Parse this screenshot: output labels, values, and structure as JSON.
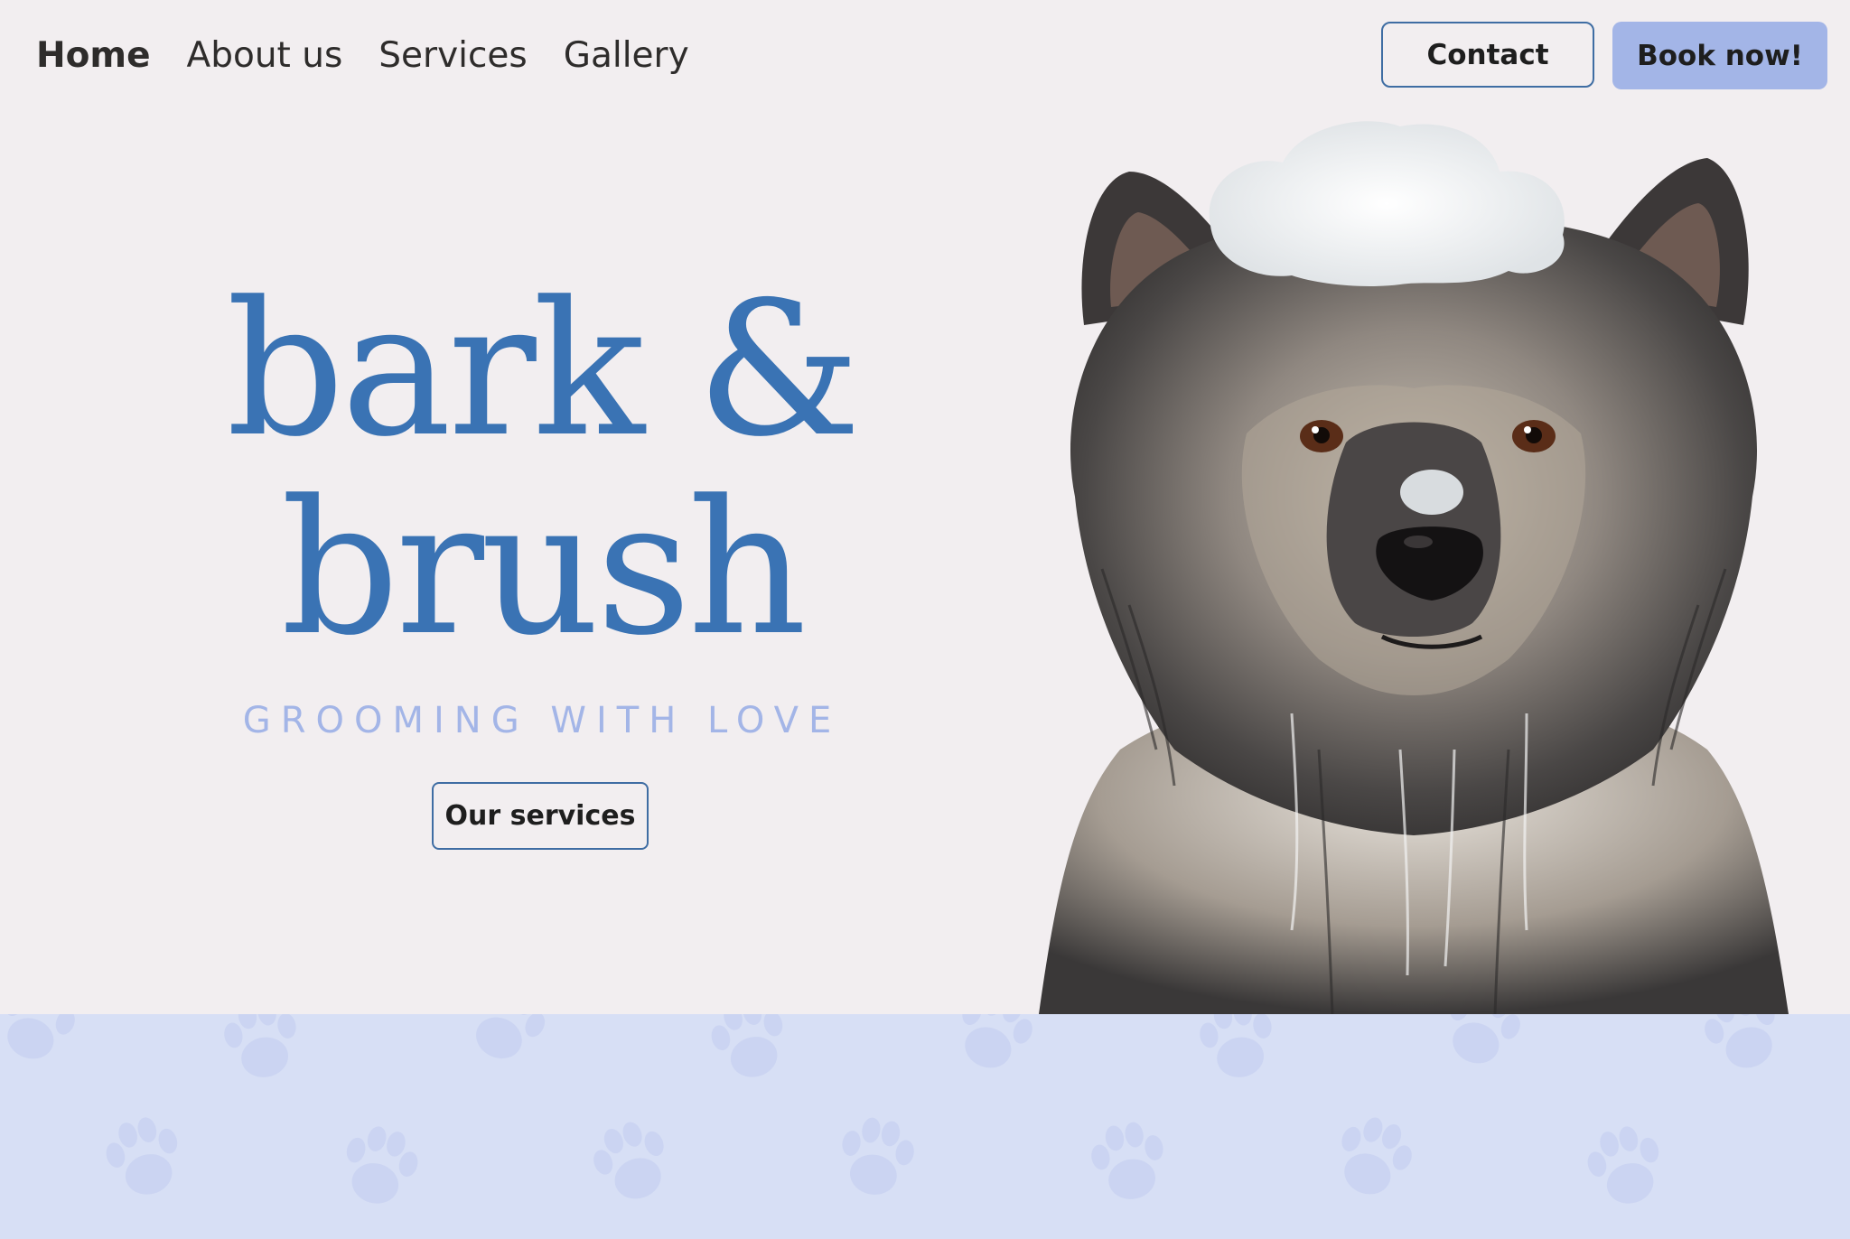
{
  "nav": {
    "links": [
      {
        "label": "Home",
        "active": true
      },
      {
        "label": "About us"
      },
      {
        "label": "Services"
      },
      {
        "label": "Gallery"
      }
    ],
    "contact_label": "Contact",
    "book_label": "Book now!"
  },
  "hero": {
    "brand_line1": "bark &",
    "brand_line2": "brush",
    "tagline": "GROOMING WITH LOVE",
    "services_button": "Our services"
  },
  "colors": {
    "background": "#f2eef0",
    "brand": "#3a73b4",
    "accent": "#a3b5e7",
    "band": "#d7dff5"
  }
}
